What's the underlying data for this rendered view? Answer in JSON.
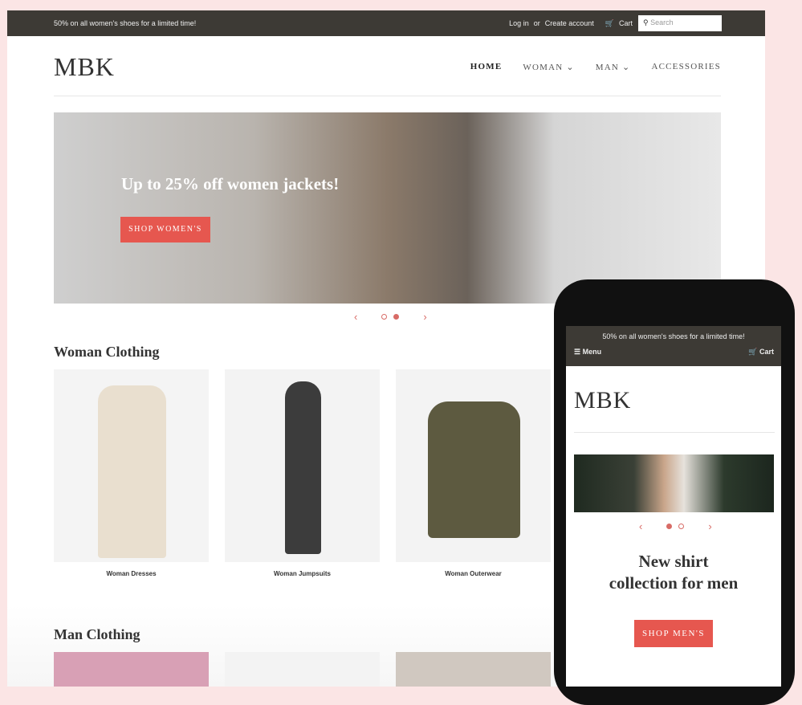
{
  "desktop": {
    "promo": "50% on all women's shoes for a limited time!",
    "login": "Log in",
    "or": "or",
    "create_account": "Create account",
    "cart": "Cart",
    "search_placeholder": "Search",
    "logo": "MBK",
    "nav": [
      "HOME",
      "WOMAN",
      "MAN",
      "ACCESSORIES"
    ],
    "hero": {
      "title": "Up to 25% off women jackets!",
      "button": "SHOP WOMEN'S"
    },
    "woman_section": "Woman Clothing",
    "woman_products": [
      "Woman Dresses",
      "Woman Jumpsuits",
      "Woman Outerwear"
    ],
    "man_section": "Man Clothing"
  },
  "mobile": {
    "promo": "50% on all women's shoes for a limited time!",
    "menu": "Menu",
    "cart": "Cart",
    "logo": "MBK",
    "hero_title_1": "New shirt",
    "hero_title_2": "collection for men",
    "button": "SHOP MEN'S"
  },
  "colors": {
    "accent": "#e6574f",
    "topbar": "#3d3a35",
    "background": "#fbe5e5"
  }
}
